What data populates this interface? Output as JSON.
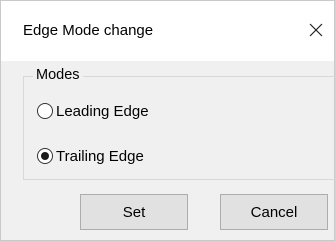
{
  "window": {
    "title": "Edge Mode change",
    "close_icon": "close-icon"
  },
  "modes_group": {
    "label": "Modes",
    "options": [
      {
        "label": "Leading Edge",
        "selected": false
      },
      {
        "label": "Trailing Edge",
        "selected": true
      }
    ]
  },
  "buttons": {
    "set_label": "Set",
    "cancel_label": "Cancel"
  },
  "colors": {
    "dialog_body": "#f0f0f0",
    "titlebar": "#ffffff",
    "button_face": "#e1e1e1",
    "button_border": "#adadad"
  }
}
